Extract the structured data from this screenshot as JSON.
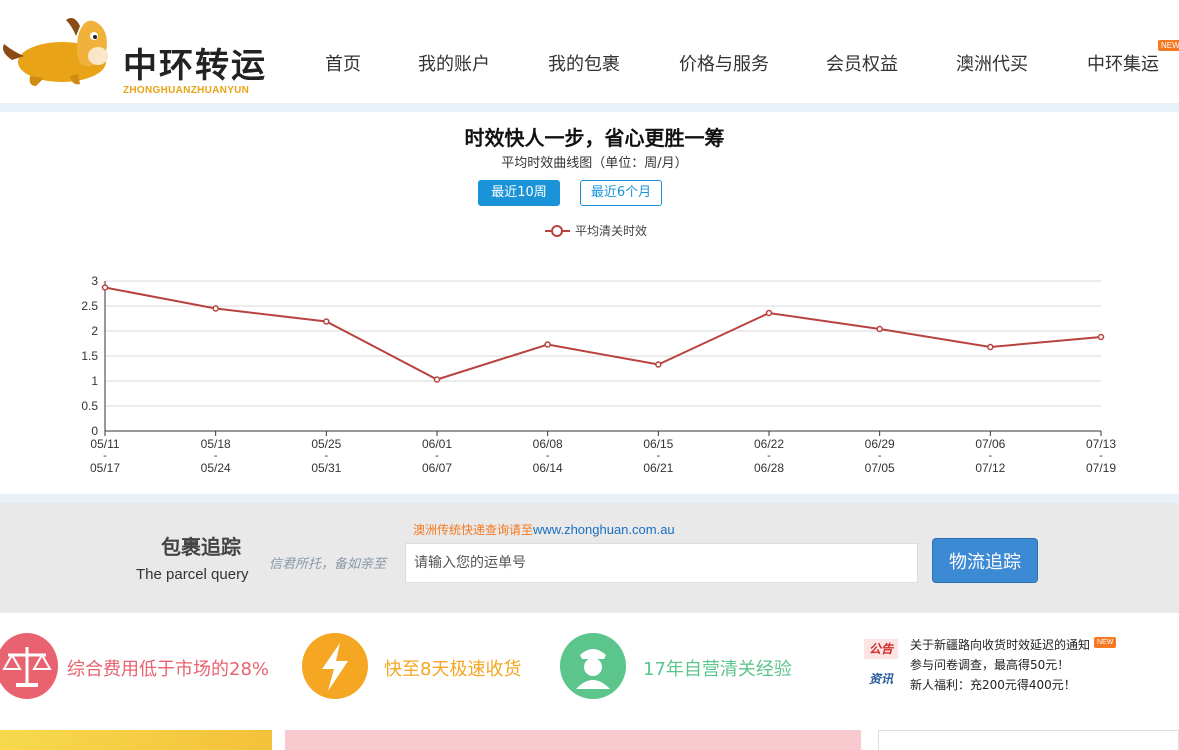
{
  "brand": {
    "name": "中环转运",
    "subtitle": "ZHONGHUANZHUANYUN"
  },
  "nav": {
    "items": [
      "首页",
      "我的账户",
      "我的包裹",
      "价格与服务",
      "会员权益",
      "澳洲代买",
      "中环集运"
    ],
    "new_badge": "NEW"
  },
  "chart_section": {
    "headline": "时效快人一步，省心更胜一筹",
    "subtitle": "平均时效曲线图（单位：周/月）",
    "toggle_active": "最近10周",
    "toggle_idle": "最近6个月"
  },
  "chart_data": {
    "type": "line",
    "title": "",
    "xlabel": "",
    "ylabel": "",
    "ylim": [
      0,
      3
    ],
    "yticks": [
      0,
      0.5,
      1,
      1.5,
      2,
      2.5,
      3
    ],
    "grid": true,
    "legend_position": "top-center",
    "categories": [
      [
        "05/11",
        "05/17"
      ],
      [
        "05/18",
        "05/24"
      ],
      [
        "05/25",
        "05/31"
      ],
      [
        "06/01",
        "06/07"
      ],
      [
        "06/08",
        "06/14"
      ],
      [
        "06/15",
        "06/21"
      ],
      [
        "06/22",
        "06/28"
      ],
      [
        "06/29",
        "07/05"
      ],
      [
        "07/06",
        "07/12"
      ],
      [
        "07/13",
        "07/19"
      ]
    ],
    "series": [
      {
        "name": "平均清关时效",
        "color": "#b8423f",
        "values": [
          2.87,
          2.45,
          2.19,
          1.03,
          1.73,
          1.33,
          2.36,
          2.04,
          1.68,
          1.88
        ]
      }
    ]
  },
  "tracking": {
    "title": "包裹追踪",
    "subtitle": "The parcel query",
    "slogan": "信君所托，备如亲至",
    "hint_prefix": "澳洲传统快递查询请至",
    "hint_url": "www.zhonghuan.com.au",
    "placeholder": "请输入您的运单号",
    "button": "物流追踪"
  },
  "features": [
    {
      "text": "综合费用低于市场的28%",
      "color": "#e8636f",
      "icon": "scale-icon"
    },
    {
      "text": "快至8天极速收货",
      "color": "#f5a623",
      "icon": "lightning-icon"
    },
    {
      "text": "17年自营清关经验",
      "color": "#5cc58c",
      "icon": "customs-officer-icon"
    }
  ],
  "notices": {
    "tag_announcement": "公告",
    "tag_news": "资讯",
    "lines": [
      "关于新疆路向收货时效延迟的通知",
      "参与问卷调查，最高得50元！",
      "新人福利：充200元得400元！"
    ],
    "new_badge": "NEW"
  },
  "colors": {
    "accent_blue": "#1a93d8",
    "line_red": "#b8423f",
    "orange": "#f47920"
  }
}
